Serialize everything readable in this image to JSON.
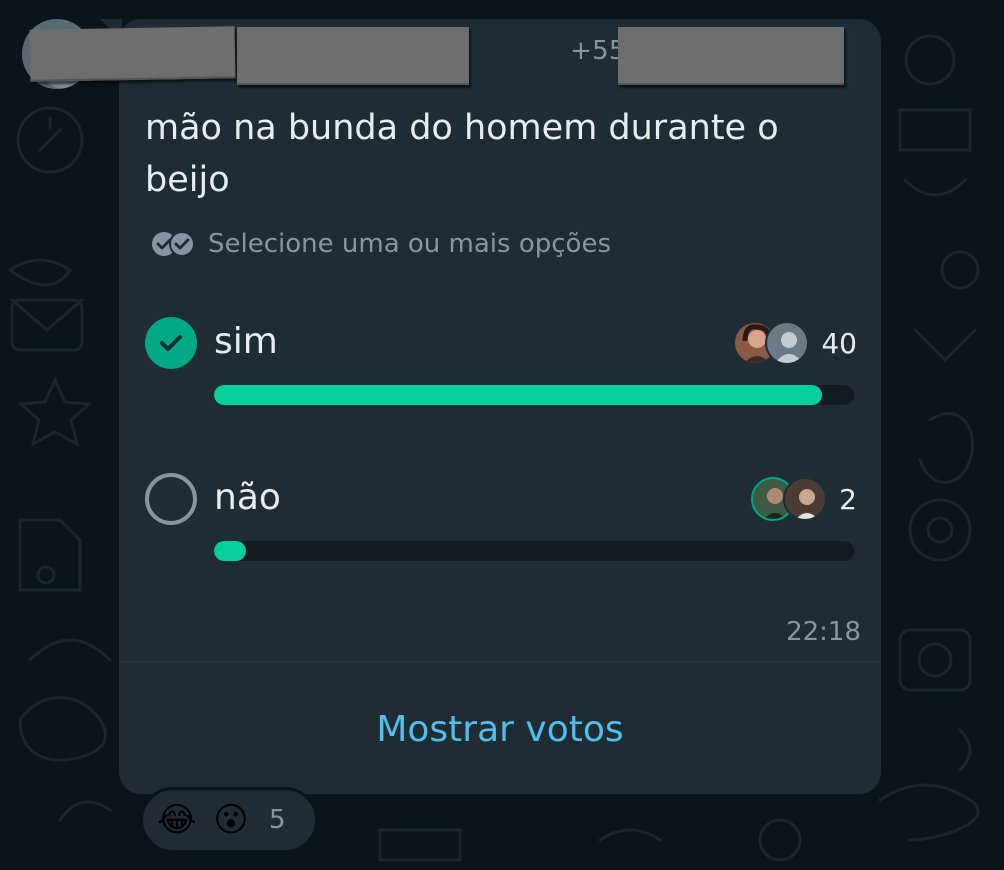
{
  "message": {
    "sender_phone": "+55",
    "question": "mão na bunda do homem durante o beijo",
    "hint": "Selecione uma ou mais opções",
    "timestamp": "22:18",
    "show_votes_label": "Mostrar votos"
  },
  "poll": {
    "options": [
      {
        "label": "sim",
        "votes": "40",
        "fill_fraction": 0.95,
        "checked": true
      },
      {
        "label": "não",
        "votes": "2",
        "fill_fraction": 0.05,
        "checked": false
      }
    ]
  },
  "reactions": {
    "emojis": [
      "😂",
      "😮"
    ],
    "count": "5"
  },
  "colors": {
    "bubble": "#1f2c34",
    "accent_green": "#00a884",
    "bar_fill": "#06cf9c",
    "link_blue": "#53bdeb",
    "secondary_text": "#8696a0"
  }
}
